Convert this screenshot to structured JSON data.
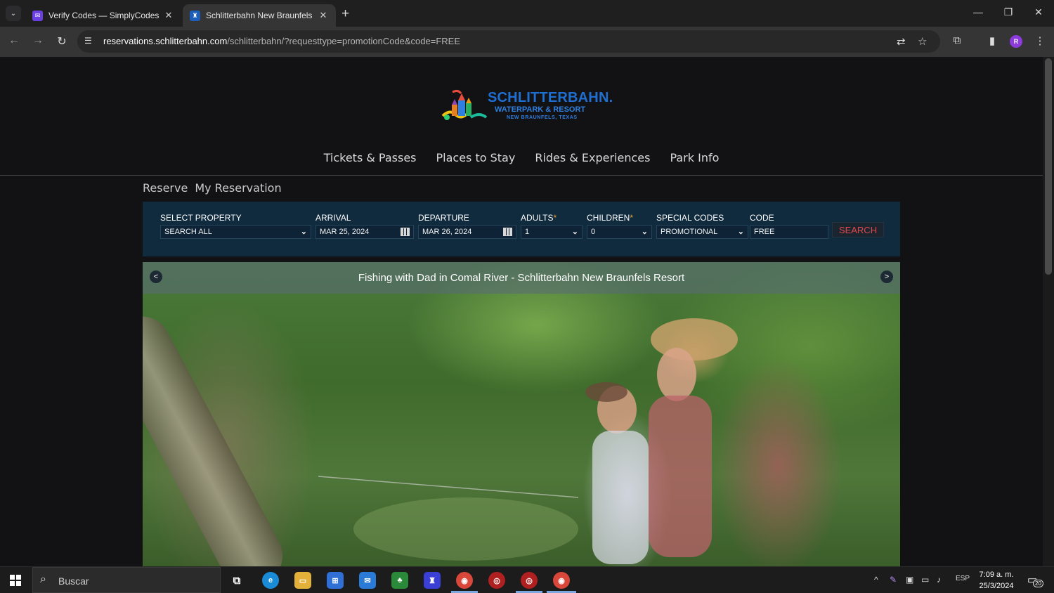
{
  "browser": {
    "tabs": [
      {
        "title": "Verify Codes — SimplyCodes",
        "favicon": "simplycodes-icon",
        "active": false
      },
      {
        "title": "Schlitterbahn New Braunfels",
        "favicon": "schlitterbahn-icon",
        "active": true
      }
    ],
    "url_host": "reservations.schlitterbahn.com",
    "url_path": "/schlitterbahn/?requesttype=promotionCode&code=FREE",
    "profile_initial": "R"
  },
  "site": {
    "logo": {
      "title": "SCHLITTERBAHN.",
      "subtitle": "WATERPARK & RESORT",
      "location": "NEW BRAUNFELS, TEXAS"
    },
    "main_nav": [
      "Tickets & Passes",
      "Places to Stay",
      "Rides & Experiences",
      "Park Info"
    ],
    "sub_nav": {
      "reserve": "Reserve",
      "my_reservation": "My Reservation"
    },
    "booking": {
      "property": {
        "label": "SELECT PROPERTY",
        "value": "SEARCH ALL"
      },
      "arrival": {
        "label": "ARRIVAL",
        "value": "MAR 25, 2024"
      },
      "departure": {
        "label": "DEPARTURE",
        "value": "MAR 26, 2024"
      },
      "adults": {
        "label": "ADULTS",
        "required_mark": "*",
        "value": "1"
      },
      "children": {
        "label": "CHILDREN",
        "required_mark": "*",
        "value": "0"
      },
      "special_codes": {
        "label": "SPECIAL CODES",
        "value": "PROMOTIONAL"
      },
      "code": {
        "label": "CODE",
        "value": "FREE"
      },
      "search_label": "SEARCH"
    },
    "hero": {
      "caption": "Fishing with Dad in Comal River - Schlitterbahn New Braunfels Resort",
      "prev_label": "<",
      "next_label": ">"
    }
  },
  "taskbar": {
    "search_placeholder": "Buscar",
    "language": "ESP",
    "time": "7:09 a. m.",
    "date": "25/3/2024",
    "notification_count": "20"
  },
  "colors": {
    "booking_bg": "#102a3e",
    "search_text": "#e0474a",
    "logo_blue": "#1f6fd2",
    "page_bg": "#121214"
  }
}
